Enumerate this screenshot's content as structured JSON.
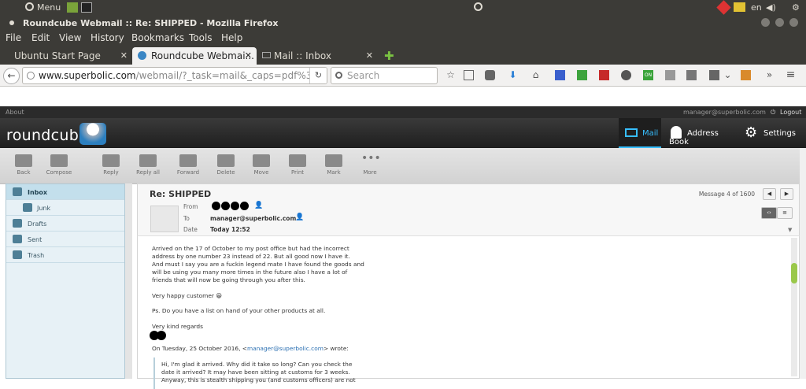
{
  "panel": {
    "menu": "Menu",
    "lang": "en"
  },
  "window": {
    "title": "Roundcube Webmail :: Re: SHIPPED - Mozilla Firefox"
  },
  "menubar": {
    "items": [
      "File",
      "Edit",
      "View",
      "History",
      "Bookmarks",
      "Tools",
      "Help"
    ]
  },
  "tabs": [
    {
      "label": "Ubuntu Start Page",
      "active": false
    },
    {
      "label": "Roundcube Webmai...",
      "active": true
    },
    {
      "label": "Mail :: Inbox",
      "active": false
    }
  ],
  "nav": {
    "url_domain": "www.superbolic.com",
    "url_path": "/webmail/?_task=mail&_caps=pdf%3D1%2",
    "search_placeholder": "Search",
    "addon_on": "ON"
  },
  "rc": {
    "about": "About",
    "user": "manager@superbolic.com",
    "logout": "Logout",
    "logo": "roundcube",
    "topnav": {
      "mail": "Mail",
      "address_book": "Address Book",
      "settings": "Settings"
    },
    "toolbar": [
      "Back",
      "Compose",
      "Reply",
      "Reply all",
      "Forward",
      "Delete",
      "Move",
      "Print",
      "Mark",
      "More"
    ],
    "folders": [
      "Inbox",
      "Junk",
      "Drafts",
      "Sent",
      "Trash"
    ]
  },
  "message": {
    "subject": "Re: SHIPPED",
    "from_label": "From",
    "to_label": "To",
    "date_label": "Date",
    "to": "manager@superbolic.com",
    "date": "Today 12:52",
    "count": "Message 4 of 1600",
    "body": [
      "Arrived on the 17 of October to my post office but had the incorrect",
      "address by one number 23 instead of 22. But all good now I have it.",
      "And must I say you are a fuckin legend mate I have found the goods and",
      "will be using you many more times in the future also I have a lot of",
      "friends that will now be going through you after this.",
      "Very happy customer 😀",
      "Ps. Do you have a list on hand of your other products at all.",
      "Very kind regards"
    ],
    "reply_prefix": "On Tuesday, 25 October 2016, <",
    "reply_email": "manager@superbolic.com",
    "reply_suffix": "> wrote:",
    "quote": [
      "Hi, I'm glad it arrived. Why did it take so long? Can you check the",
      "date it arrived? It may have been sitting at customs for 3 weeks.",
      "Anyway, this is stealth shipping you (and customs officers) are not"
    ]
  },
  "colors": {
    "accent": "#37beff",
    "panel": "#3c3b37",
    "rc_header": "#2b2b2b"
  }
}
